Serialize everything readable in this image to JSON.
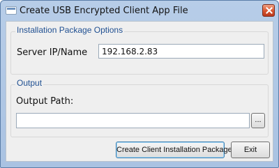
{
  "window": {
    "title": "Create USB Encrypted Client App File"
  },
  "install_group": {
    "legend": "Installation Package Options",
    "server_label": "Server IP/Name",
    "server_value": "192.168.2.83"
  },
  "output_group": {
    "legend": "Output",
    "path_label": "Output Path:",
    "path_value": "",
    "browse_label": "..."
  },
  "buttons": {
    "create_label": "Create Client Installation Package",
    "exit_label": "Exit"
  },
  "icons": {
    "app": "window-icon",
    "close": "close-icon"
  },
  "colors": {
    "close_button": "#d8542f",
    "legend_text": "#1f4f91",
    "titlebar": "#b7cde8"
  }
}
